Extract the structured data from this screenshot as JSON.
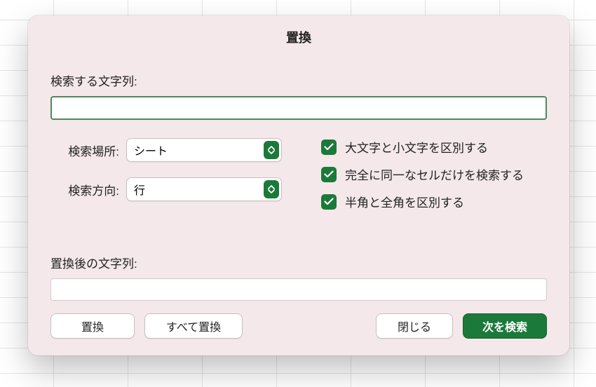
{
  "dialog": {
    "title": "置換",
    "search_label": "検索する文字列:",
    "search_value": "",
    "within_label": "検索場所:",
    "within_value": "シート",
    "direction_label": "検索方向:",
    "direction_value": "行",
    "match_case_label": "大文字と小文字を区別する",
    "match_case_checked": true,
    "match_entire_label": "完全に同一なセルだけを検索する",
    "match_entire_checked": true,
    "match_width_label": "半角と全角を区別する",
    "match_width_checked": true,
    "replace_label": "置換後の文字列:",
    "replace_value": ""
  },
  "buttons": {
    "replace": "置換",
    "replace_all": "すべて置換",
    "close": "閉じる",
    "find_next": "次を検索"
  }
}
